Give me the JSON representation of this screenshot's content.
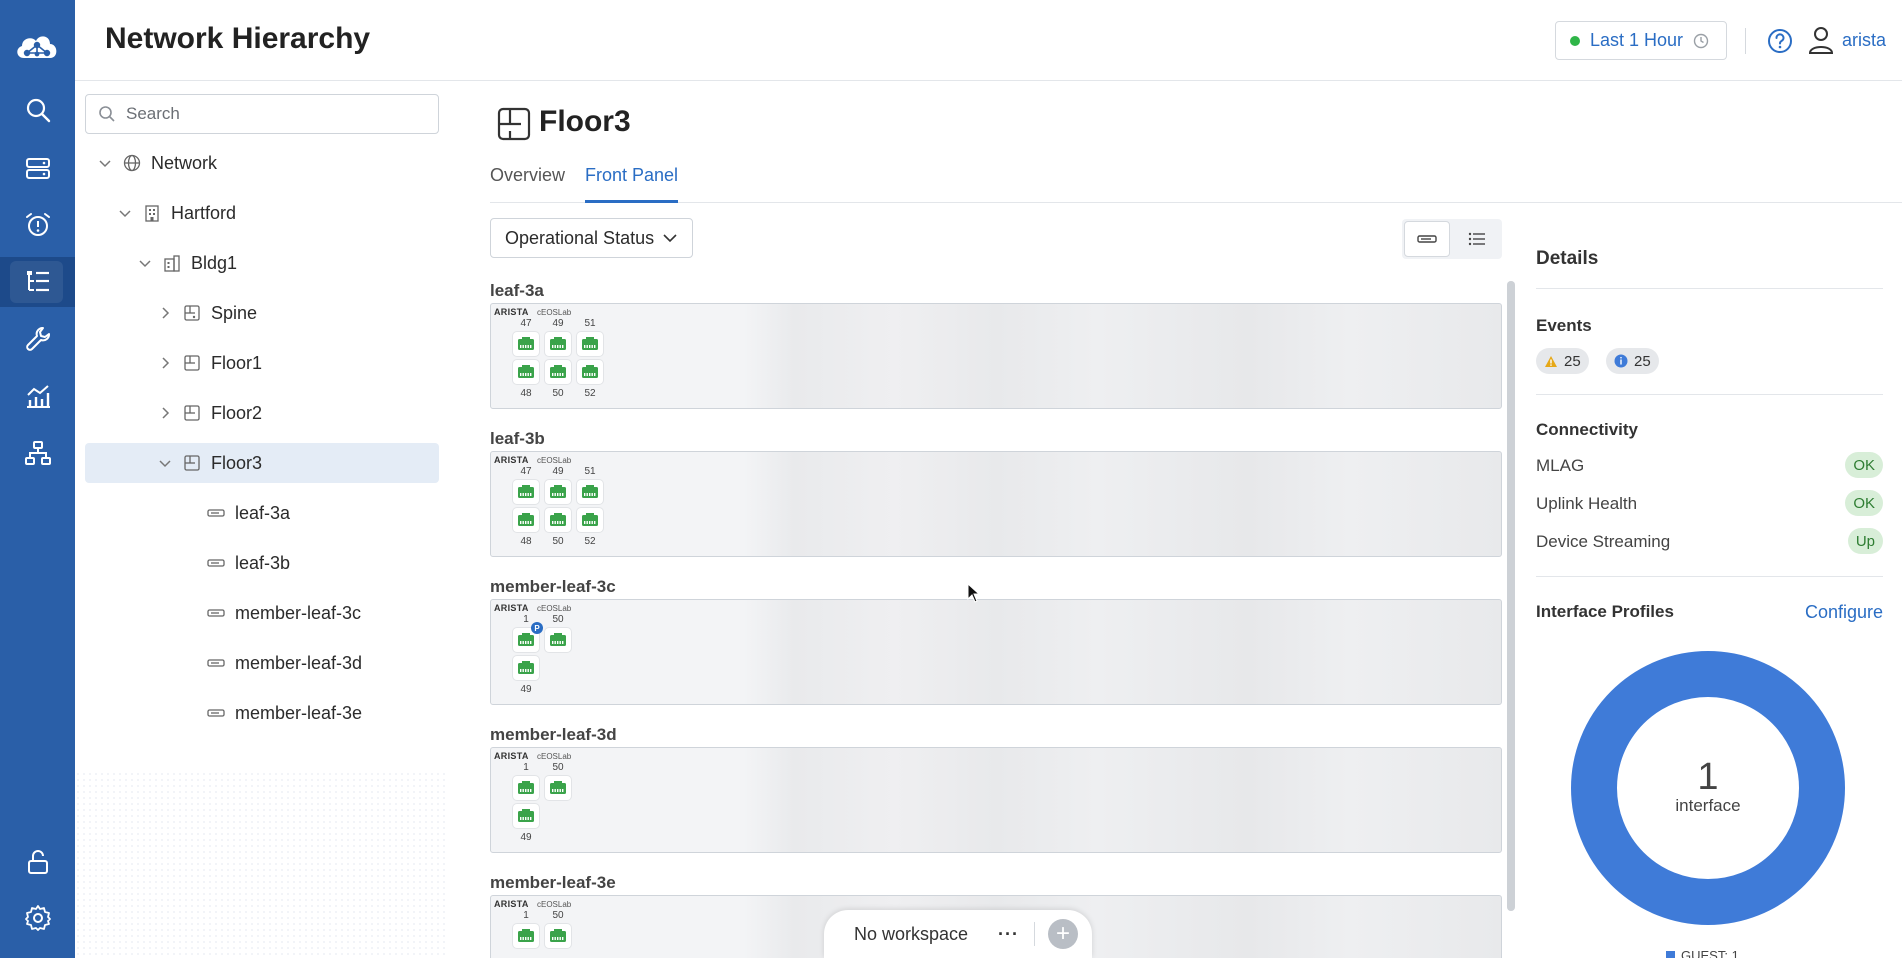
{
  "header": {
    "title": "Network Hierarchy",
    "time_range": "Last 1 Hour",
    "user": "arista"
  },
  "rail": {
    "items": [
      "search-icon",
      "devices-icon",
      "alarm-icon",
      "hierarchy-icon",
      "wrench-icon",
      "dashboard-icon",
      "topology-icon",
      "unlock-icon",
      "gear-icon"
    ],
    "active": "hierarchy-icon"
  },
  "tree": {
    "search_placeholder": "Search",
    "nodes": {
      "network": "Network",
      "hartford": "Hartford",
      "bldg1": "Bldg1",
      "spine": "Spine",
      "floor1": "Floor1",
      "floor2": "Floor2",
      "floor3": "Floor3",
      "leaf3a": "leaf-3a",
      "leaf3b": "leaf-3b",
      "leaf3c": "member-leaf-3c",
      "leaf3d": "member-leaf-3d",
      "leaf3e": "member-leaf-3e"
    }
  },
  "main": {
    "title": "Floor3",
    "tabs": [
      "Overview",
      "Front Panel"
    ],
    "active_tab": "Front Panel",
    "filter": "Operational Status"
  },
  "devices": [
    {
      "name": "leaf-3a",
      "brand": "ARISTA",
      "model": "cEOSLab",
      "top_ports": [
        "47",
        "49",
        "51"
      ],
      "bottom_ports": [
        "48",
        "50",
        "52"
      ]
    },
    {
      "name": "leaf-3b",
      "brand": "ARISTA",
      "model": "cEOSLab",
      "top_ports": [
        "47",
        "49",
        "51"
      ],
      "bottom_ports": [
        "48",
        "50",
        "52"
      ]
    },
    {
      "name": "member-leaf-3c",
      "brand": "ARISTA",
      "model": "cEOSLab",
      "top_ports": [
        "1",
        "50"
      ],
      "bottom_ports": [
        "49"
      ],
      "badge": "P"
    },
    {
      "name": "member-leaf-3d",
      "brand": "ARISTA",
      "model": "cEOSLab",
      "top_ports": [
        "1",
        "50"
      ],
      "bottom_ports": [
        "49"
      ]
    },
    {
      "name": "member-leaf-3e",
      "brand": "ARISTA",
      "model": "cEOSLab",
      "top_ports": [
        "1",
        "50"
      ],
      "bottom_ports": []
    }
  ],
  "workspace": {
    "label": "No workspace",
    "more": "···",
    "add": "+"
  },
  "details": {
    "title": "Details",
    "events_title": "Events",
    "warning_count": "25",
    "info_count": "25",
    "connectivity_title": "Connectivity",
    "mlag_label": "MLAG",
    "mlag_status": "OK",
    "uplink_label": "Uplink Health",
    "uplink_status": "OK",
    "streaming_label": "Device Streaming",
    "streaming_status": "Up",
    "profiles_title": "Interface Profiles",
    "configure": "Configure",
    "donut_value": "1",
    "donut_label": "interface",
    "legend": "GUEST: 1"
  },
  "colors": {
    "rail": "#2a5fa8",
    "accent": "#2a6dc4",
    "port_green": "#3aa34a",
    "donut": "#3f7bd8"
  }
}
